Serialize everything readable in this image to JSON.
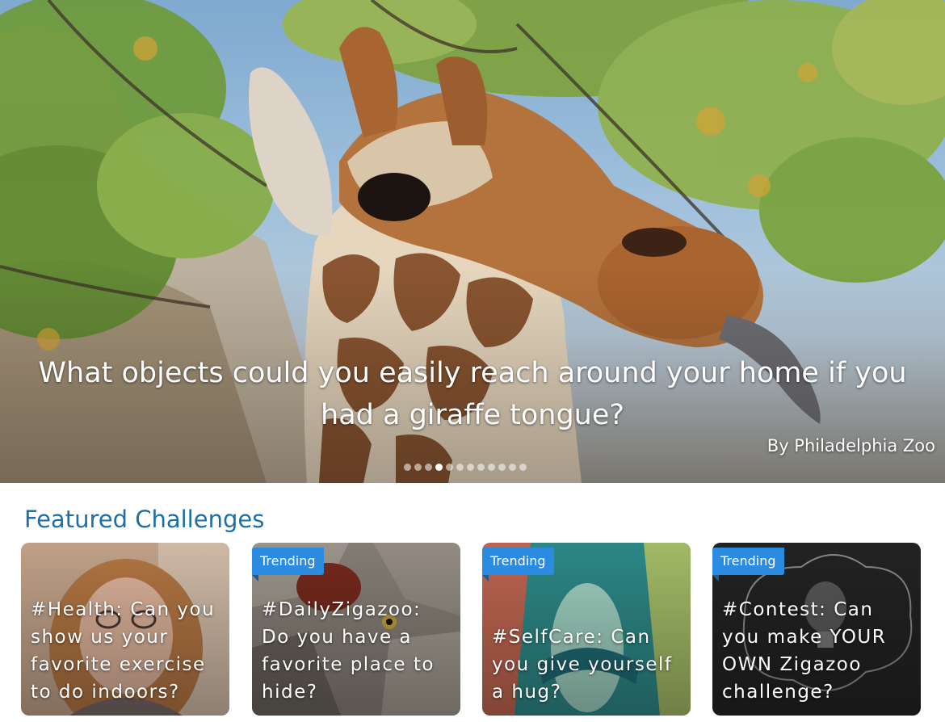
{
  "hero": {
    "question": "What objects could you easily reach around your home if you had a giraffe tongue?",
    "credit": "By Philadelphia Zoo",
    "slide_count": 12,
    "active_slide": 4
  },
  "featured": {
    "title": "Featured Challenges",
    "cards": [
      {
        "text": "#Health: Can you show us your favorite exercise to do indoors?",
        "badge": ""
      },
      {
        "text": "#DailyZigazoo: Do you have a favorite place to hide?",
        "badge": "Trending"
      },
      {
        "text": "#SelfCare: Can you give yourself a hug?",
        "badge": "Trending"
      },
      {
        "text": "#Contest: Can you make YOUR OWN Zigazoo challenge?",
        "badge": "Trending"
      }
    ]
  },
  "colors": {
    "accent": "#1d6fa8",
    "badge": "#2a8be0"
  }
}
